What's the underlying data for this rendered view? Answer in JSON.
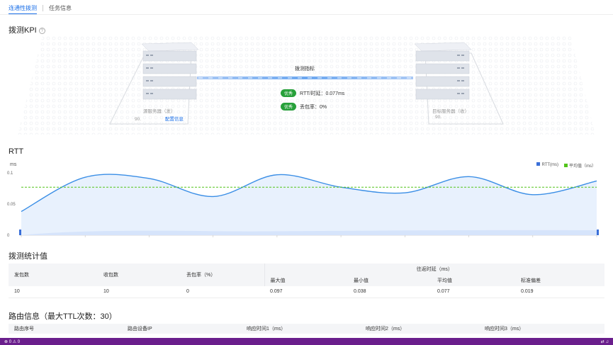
{
  "tabs": [
    {
      "label": "连通性拨测"
    },
    {
      "label": "任务信息"
    }
  ],
  "kpi": {
    "title": "拨测KPI",
    "center_label": "拨测指标",
    "source": {
      "label": "源服务器（发）",
      "ip": "90.",
      "config_link": "配置信息"
    },
    "target": {
      "label": "目标服务器（收）",
      "ip": "90."
    },
    "metrics": [
      {
        "badge": "优秀",
        "text": "RTT/时延：0.077ms"
      },
      {
        "badge": "优秀",
        "text": "丢包率：0%"
      }
    ]
  },
  "rtt": {
    "title": "RTT",
    "unit": "ms",
    "legend": [
      {
        "name": "RTT(ms)",
        "color": "#3a6fd8"
      },
      {
        "name": "平均值（ms）",
        "color": "#52c41a"
      }
    ]
  },
  "chart_data": {
    "type": "area",
    "ylabel": "ms",
    "ylim": [
      0,
      0.1
    ],
    "yticks": [
      "0",
      "0.05",
      "0.1"
    ],
    "x": [
      1,
      2,
      3,
      4,
      5,
      6,
      7,
      8,
      9,
      10
    ],
    "series": [
      {
        "name": "RTT(ms)",
        "values": [
          0.038,
          0.093,
          0.091,
          0.062,
          0.097,
          0.077,
          0.068,
          0.094,
          0.065,
          0.087
        ]
      }
    ],
    "average": {
      "name": "平均值（ms）",
      "value": 0.077
    },
    "colors": {
      "line": "#3a8ee6",
      "fill": "#e8f1fd",
      "avg": "#52c41a"
    }
  },
  "stats": {
    "title": "拨测统计值",
    "headers": {
      "sent": "发包数",
      "received": "收包数",
      "loss": "丢包率（%）",
      "rtt_group": "往返时延（ms）",
      "max": "最大值",
      "min": "最小值",
      "avg": "平均值",
      "std": "标准偏差"
    },
    "row": {
      "sent": "10",
      "received": "10",
      "loss": "0",
      "max": "0.097",
      "min": "0.038",
      "avg": "0.077",
      "std": "0.019"
    }
  },
  "route": {
    "title": "路由信息（最大TTL次数：30）",
    "headers": [
      "路由序号",
      "路由设备IP",
      "响应时间1（ms）",
      "响应时间2（ms）",
      "响应时间3（ms）"
    ]
  },
  "statusbar": {
    "left": "⊗ 0 ⚠ 0"
  }
}
